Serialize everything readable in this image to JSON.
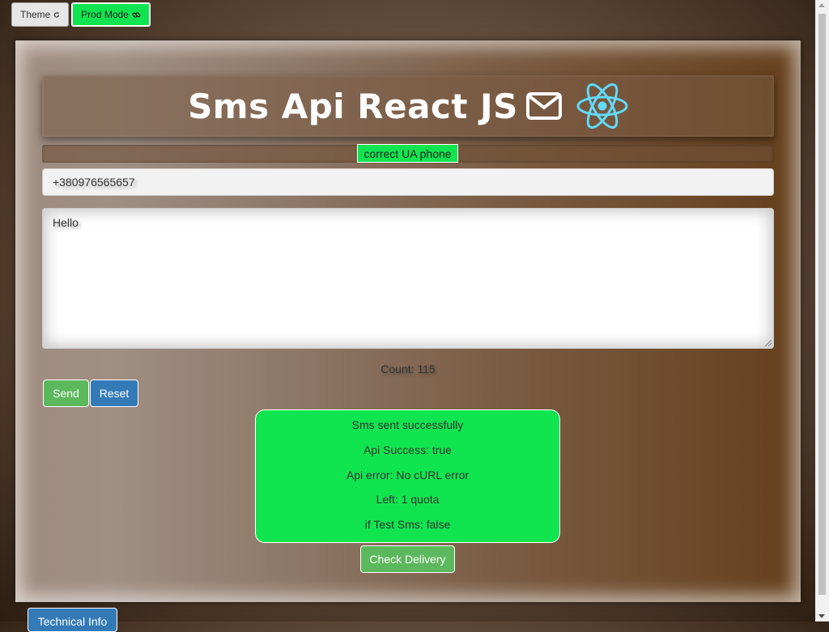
{
  "toolbar": {
    "theme_label": "Theme",
    "theme_icon": "refresh-icon",
    "prod_label": "Prod Mode",
    "prod_icon": "link-icon"
  },
  "header": {
    "title": "Sms Api React JS",
    "envelope_icon": "envelope-icon",
    "logo_icon": "react-logo-icon"
  },
  "phone_status": "correct UA phone",
  "phone": {
    "value": "+380976565657"
  },
  "message": {
    "value": "Hello"
  },
  "count_text": "Count: 115",
  "actions": {
    "send_label": "Send",
    "reset_label": "Reset"
  },
  "result": {
    "lines": [
      "Sms sent successfully",
      "Api Success: true",
      "Api error: No cURL error",
      "Left: 1 quota",
      "if Test Sms: false"
    ]
  },
  "check_delivery_label": "Check Delivery",
  "technical_info_label": "Technical Info",
  "colors": {
    "success_green": "#10e54f",
    "primary_blue": "#337ab7",
    "button_green": "#5cb85c"
  }
}
